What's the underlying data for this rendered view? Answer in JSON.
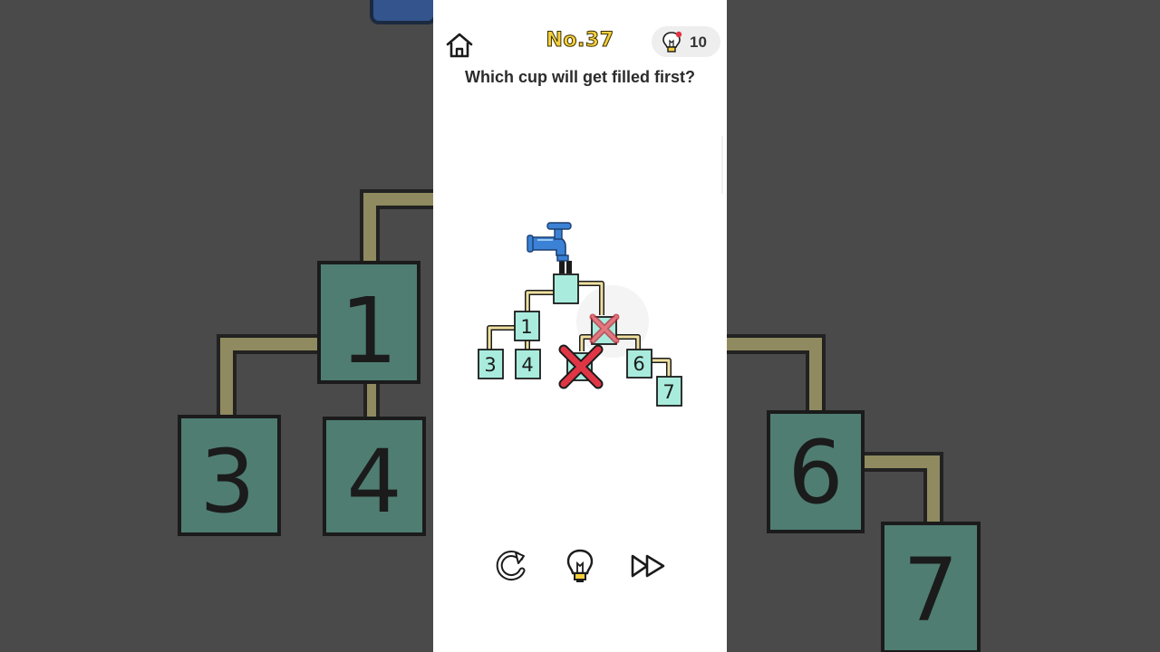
{
  "header": {
    "level": "No.37",
    "hint_count": "10"
  },
  "question": "Which cup will get filled first?",
  "cups": {
    "top": "",
    "cup_1": "1",
    "cup_3": "3",
    "cup_4": "4",
    "cup_6": "6",
    "cup_7": "7"
  },
  "icons": {
    "home": "home-icon",
    "hint": "lightbulb-icon",
    "restart": "restart-icon",
    "hint_button": "lightbulb-icon",
    "skip": "fast-forward-icon",
    "tap": "faucet-icon",
    "blocked": "red-x-icon"
  },
  "colors": {
    "cup_fill": "#a9ecdd",
    "pipe_fill": "#f0e0a0",
    "level_title": "#f4cf3c",
    "faucet": "#3b82d6",
    "blocked_mark": "#e03545",
    "background_dim": "#4a4a4a",
    "background_cup": "#4f7d72"
  }
}
